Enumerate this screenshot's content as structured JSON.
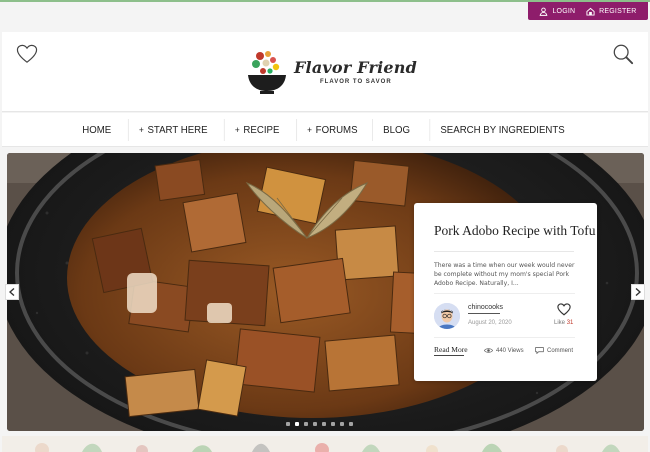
{
  "auth": {
    "login": "LOGIN",
    "register": "REGISTER"
  },
  "brand": {
    "name": "Flavor Friend",
    "tagline": "FLAVOR TO SAVOR"
  },
  "nav": {
    "home": "HOME",
    "start_here": "START HERE",
    "recipe": "RECIPE",
    "forums": "FORUMS",
    "blog": "BLOG",
    "search_by_ingredients": "SEARCH BY INGREDIENTS"
  },
  "slide": {
    "title": "Pork Adobo Recipe with Tofu",
    "excerpt": "There was a time when our week would never be complete without my mom's special Pork Adobo Recipe. Naturally, I...",
    "author": "chinocooks",
    "date": "August 20, 2020",
    "like_label": "Like",
    "like_count": "31",
    "read_more": "Read More",
    "views": "440 Views",
    "comment": "Comment"
  },
  "slider": {
    "total": 8,
    "active_index": 1
  },
  "colors": {
    "accent": "#8e1d6b",
    "top_border": "#8dbf8b",
    "like_count": "#c0392b"
  },
  "icons": {
    "heart": "heart-icon",
    "search": "search-icon",
    "user": "user-icon",
    "register": "register-icon",
    "eye": "eye-icon",
    "comment": "comment-icon",
    "prev": "chevron-left-icon",
    "next": "chevron-right-icon"
  }
}
